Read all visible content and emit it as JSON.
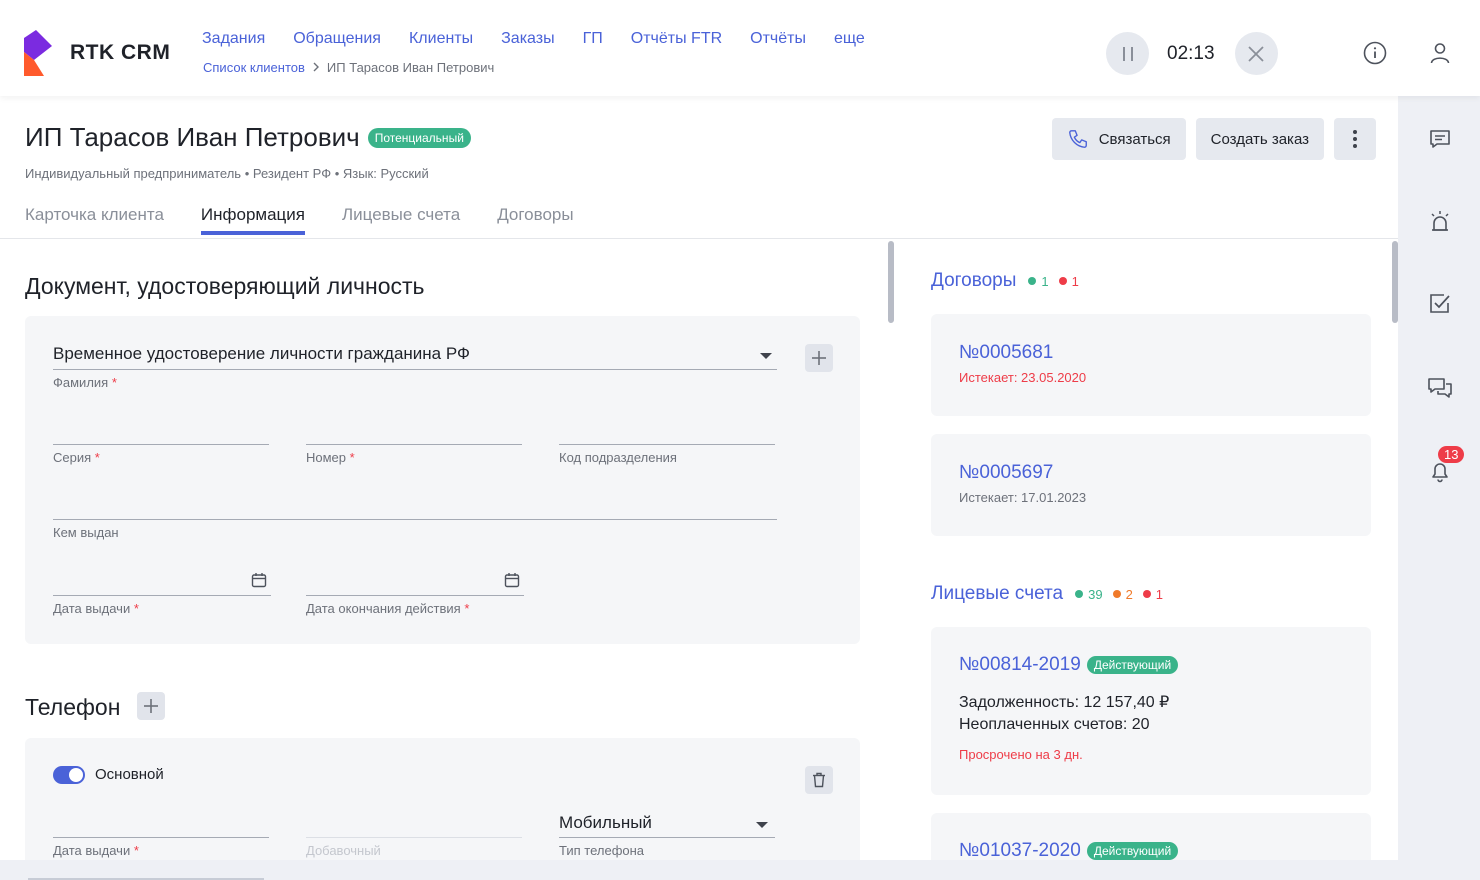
{
  "app": {
    "logo_text": "RTK CRM"
  },
  "nav": [
    "Задания",
    "Обращения",
    "Клиенты",
    "Заказы",
    "ГП",
    "Отчёты FTR",
    "Отчёты",
    "еще"
  ],
  "breadcrumb": {
    "parent": "Список клиентов",
    "current": "ИП Тарасов Иван Петрович"
  },
  "call": {
    "timer": "02:13"
  },
  "client": {
    "name": "ИП Тарасов Иван Петрович",
    "status": "Потенциальный",
    "subtitle": "Индивидуальный предприниматель • Резидент РФ • Язык: Русский"
  },
  "actions": {
    "contact": "Связаться",
    "create_order": "Создать заказ"
  },
  "tabs": [
    "Карточка клиента",
    "Информация",
    "Лицевые счета",
    "Договоры"
  ],
  "document": {
    "title": "Документ, удостоверяющий личность",
    "type_value": "Временное удостоверение личности гражданина РФ",
    "surname_label": "Фамилия",
    "series_label": "Серия",
    "number_label": "Номер",
    "division_code_label": "Код подразделения",
    "issued_by_label": "Кем выдан",
    "issue_date_label": "Дата выдачи",
    "expiry_date_label": "Дата окончания действия",
    "required_mark": "*"
  },
  "phone": {
    "title": "Телефон",
    "main_label": "Основной",
    "main_enabled": true,
    "issue_date_label": "Дата выдачи",
    "extension_label": "Добавочный",
    "type_value": "Мобильный",
    "type_label": "Тип телефона"
  },
  "contracts": {
    "title": "Договоры",
    "stats": [
      {
        "color": "#3ab38a",
        "count": "1"
      },
      {
        "color": "#ee3c48",
        "count": "1"
      }
    ],
    "items": [
      {
        "number": "№0005681",
        "expires": "Истекает: 23.05.2020",
        "expires_color": "#ee3c48"
      },
      {
        "number": "№0005697",
        "expires": "Истекает: 17.01.2023",
        "expires_color": "#6d717a"
      }
    ]
  },
  "accounts": {
    "title": "Лицевые счета",
    "stats": [
      {
        "color": "#3ab38a",
        "count": "39"
      },
      {
        "color": "#f07a2a",
        "count": "2"
      },
      {
        "color": "#ee3c48",
        "count": "1"
      }
    ],
    "items": [
      {
        "number": "№00814-2019",
        "status": "Действующий",
        "debt": "Задолженность: 12 157,40 ₽",
        "unpaid": "Неоплаченных счетов: 20",
        "overdue": "Просрочено на 3 дн."
      },
      {
        "number": "№01037-2020",
        "status": "Действующий"
      }
    ]
  },
  "rail": {
    "notifications_count": "13"
  },
  "colors": {
    "accent": "#4a62d8",
    "success": "#3ab38a",
    "danger": "#ee3c48",
    "warning": "#f07a2a"
  }
}
